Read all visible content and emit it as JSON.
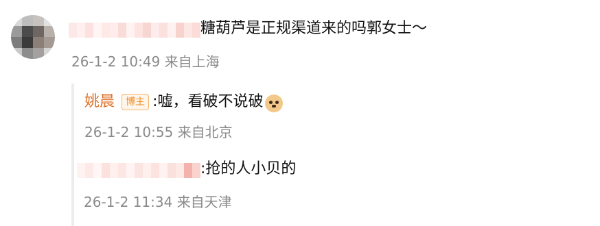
{
  "comment": {
    "text": "糖葫芦是正规渠道来的吗郭女士～",
    "time": "26-1-2 10:49",
    "location": "来自上海"
  },
  "replies": [
    {
      "author": "姚晨",
      "badge": "博主",
      "text": ":嘘，看破不说破",
      "emoji": "doge-emoji",
      "time": "26-1-2 10:55",
      "location": "来自北京"
    },
    {
      "text": ":抢的人小贝的",
      "time": "26-1-2 11:34",
      "location": "来自天津"
    }
  ],
  "colors": {
    "author": "#e0742b",
    "meta": "#8a8a8a",
    "thread_line": "#ececec",
    "badge_border": "#f6b36a"
  }
}
